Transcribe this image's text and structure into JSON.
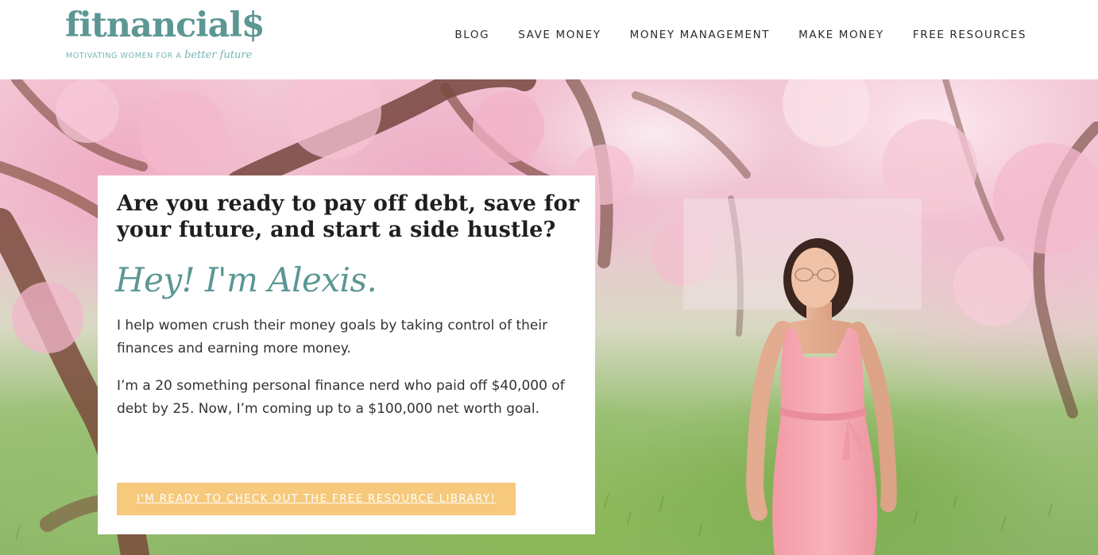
{
  "header": {
    "logo": {
      "wordmark": "fitnancial$",
      "tagline_main": "MOTIVATING WOMEN FOR A ",
      "tagline_script": "better future"
    },
    "nav": [
      {
        "label": "BLOG"
      },
      {
        "label": "SAVE MONEY"
      },
      {
        "label": "MONEY MANAGEMENT"
      },
      {
        "label": "MAKE MONEY"
      },
      {
        "label": "FREE RESOURCES"
      }
    ]
  },
  "hero": {
    "headline": "Are you ready to pay off debt, save for your future, and start a side hustle?",
    "greeting": "Hey! I'm Alexis.",
    "paragraph_1": "I help women crush their money goals by taking control of their finances and earning more money.",
    "paragraph_2": "I’m a 20 something personal finance nerd who paid off $40,000 of debt by 25. Now, I’m coming up to a $100,000 net worth goal.",
    "cta_label": "I'M READY TO CHECK OUT THE FREE RESOURCE LIBRARY!"
  },
  "colors": {
    "brand_teal": "#5c9794",
    "tagline_teal": "#74b6b2",
    "cta_yellow": "#f6c97c",
    "dress_pink": "#f6a7b0",
    "blossom_pink": "#efc3d2"
  }
}
